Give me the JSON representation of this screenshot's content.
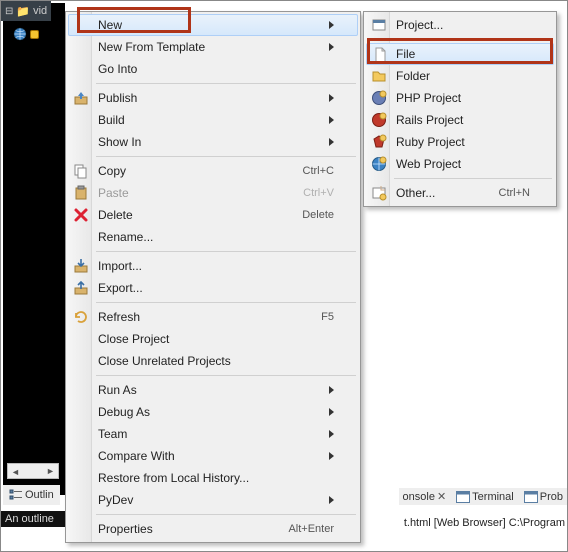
{
  "window": {
    "tab_title": "vid"
  },
  "menu_main": {
    "items": [
      {
        "label": "New",
        "submenu": true,
        "hover": true,
        "annot": true
      },
      {
        "label": "New From Template",
        "submenu": true
      },
      {
        "label": "Go Into"
      },
      {
        "sep": true
      },
      {
        "label": "Publish",
        "submenu": true,
        "icon": "publish-icon"
      },
      {
        "label": "Build",
        "submenu": true
      },
      {
        "label": "Show In",
        "submenu": true
      },
      {
        "sep": true
      },
      {
        "label": "Copy",
        "accel": "Ctrl+C",
        "icon": "copy-icon"
      },
      {
        "label": "Paste",
        "accel": "Ctrl+V",
        "icon": "paste-icon",
        "disabled": true
      },
      {
        "label": "Delete",
        "accel": "Delete",
        "icon": "delete-icon"
      },
      {
        "label": "Rename..."
      },
      {
        "sep": true
      },
      {
        "label": "Import...",
        "icon": "import-icon"
      },
      {
        "label": "Export...",
        "icon": "export-icon"
      },
      {
        "sep": true
      },
      {
        "label": "Refresh",
        "accel": "F5",
        "icon": "refresh-icon"
      },
      {
        "label": "Close Project"
      },
      {
        "label": "Close Unrelated Projects"
      },
      {
        "sep": true
      },
      {
        "label": "Run As",
        "submenu": true
      },
      {
        "label": "Debug As",
        "submenu": true
      },
      {
        "label": "Team",
        "submenu": true
      },
      {
        "label": "Compare With",
        "submenu": true
      },
      {
        "label": "Restore from Local History..."
      },
      {
        "label": "PyDev",
        "submenu": true
      },
      {
        "sep": true
      },
      {
        "label": "Properties",
        "accel": "Alt+Enter"
      }
    ]
  },
  "menu_sub": {
    "items": [
      {
        "label": "Project...",
        "icon": "project-icon"
      },
      {
        "sep": true
      },
      {
        "label": "File",
        "icon": "file-icon",
        "hover": true,
        "annot": true
      },
      {
        "label": "Folder",
        "icon": "folder-icon"
      },
      {
        "label": "PHP Project",
        "icon": "php-icon"
      },
      {
        "label": "Rails Project",
        "icon": "rails-icon"
      },
      {
        "label": "Ruby Project",
        "icon": "ruby-icon"
      },
      {
        "label": "Web Project",
        "icon": "web-icon"
      },
      {
        "sep": true
      },
      {
        "label": "Other...",
        "accel": "Ctrl+N",
        "icon": "other-icon"
      }
    ]
  },
  "bottom_tabs": {
    "left": "Outlin"
  },
  "right_tabs": {
    "console": "onsole",
    "console_x": "✕",
    "terminal": "Terminal",
    "prob": "Prob"
  },
  "outline_blurb": "An outline",
  "status_right": "t.html [Web Browser] C:\\Program",
  "icons": {
    "minus": "⊟",
    "folder": "📁"
  }
}
